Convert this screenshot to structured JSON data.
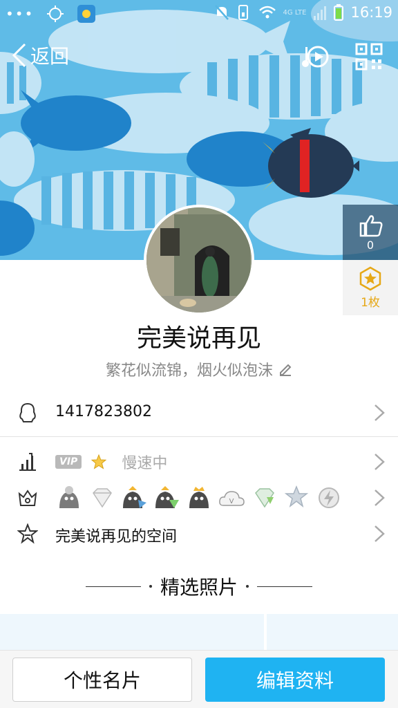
{
  "status_bar": {
    "time": "16:19",
    "network": "4G LTE",
    "icons": [
      "menu-dots-icon",
      "location-icon",
      "weather-icon",
      "mute-icon",
      "vibrate-icon",
      "wifi-icon",
      "signal-icon",
      "battery-icon"
    ]
  },
  "nav": {
    "back_label": "返回",
    "icons": [
      "music-icon",
      "qr-code-icon"
    ]
  },
  "profile": {
    "nickname": "完美说再见",
    "signature": "繁花似流锦，烟火似泡沫",
    "like_count": "0",
    "badge_count": "1枚"
  },
  "rows": {
    "qq_number": "1417823802",
    "vip_tag": "VIP",
    "vip_status": "慢速中",
    "level_icons": [
      "moon-icon",
      "diamond-icon",
      "penguin-blue-icon",
      "penguin-green-icon",
      "crown-penguin-icon",
      "cloud-vip-icon",
      "green-diamond-icon",
      "star-icon",
      "lightning-icon"
    ],
    "space_label": "完美说再见的空间"
  },
  "photos": {
    "title": "精选照片"
  },
  "bottom": {
    "card_label": "个性名片",
    "edit_label": "编辑资料"
  },
  "colors": {
    "accent": "#1fb3f2",
    "cover_bg": "#56b6e4",
    "badge_gold": "#e6a817"
  }
}
